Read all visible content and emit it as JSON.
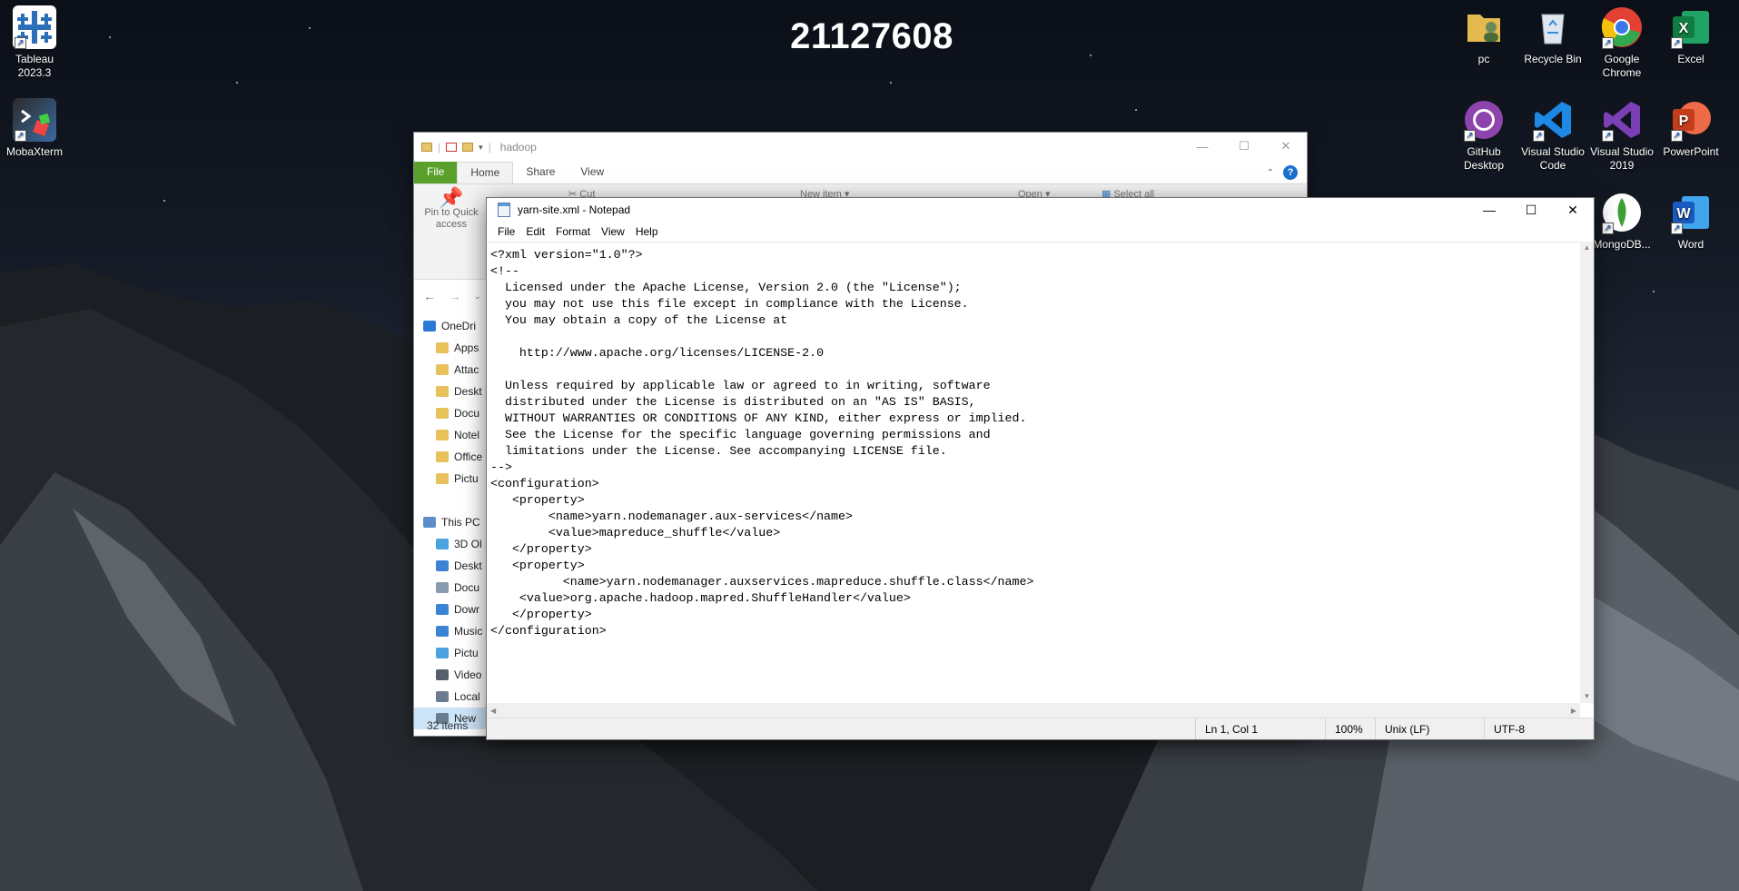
{
  "desktop": {
    "number": "21127608",
    "icons": [
      {
        "label": "Tableau 2023.3",
        "icon": "tableau-icon",
        "color": "#2c6fb8"
      },
      {
        "label": "MobaXterm",
        "icon": "mobaxterm-icon",
        "color": "#3b6aa0"
      },
      {
        "label": "pc",
        "icon": "user-folder-icon",
        "color": "#e4b94d"
      },
      {
        "label": "Recycle Bin",
        "icon": "recycle-bin-icon",
        "color": "#c9d2dc"
      },
      {
        "label": "Google Chrome",
        "icon": "chrome-icon",
        "color": "#e34133"
      },
      {
        "label": "Excel",
        "icon": "excel-icon",
        "color": "#1d7044"
      },
      {
        "label": "GitHub Desktop",
        "icon": "github-desktop-icon",
        "color": "#8e44ad"
      },
      {
        "label": "Visual Studio Code",
        "icon": "vscode-icon",
        "color": "#1e88e5"
      },
      {
        "label": "Visual Studio 2019",
        "icon": "visual-studio-icon",
        "color": "#7b3fb6"
      },
      {
        "label": "PowerPoint",
        "icon": "powerpoint-icon",
        "color": "#c9432a"
      },
      {
        "label": "MongoDB...",
        "icon": "mongodb-icon",
        "color": "#3fa037"
      },
      {
        "label": "Word",
        "icon": "word-icon",
        "color": "#2b5bb5"
      }
    ]
  },
  "explorer": {
    "title": "hadoop",
    "tabs": {
      "file": "File",
      "home": "Home",
      "share": "Share",
      "view": "View"
    },
    "ribbon": {
      "pin": "Pin to Quick access",
      "cut": "Cut",
      "new_item": "New item",
      "open": "Open",
      "select_all": "Select all"
    },
    "sidebar": [
      {
        "label": "OneDri",
        "icon": "onedrive-icon",
        "color": "#2a7ad5",
        "head": true
      },
      {
        "label": "Apps",
        "icon": "folder-icon",
        "color": "#e8c15a"
      },
      {
        "label": "Attac",
        "icon": "folder-icon",
        "color": "#e8c15a"
      },
      {
        "label": "Deskt",
        "icon": "folder-icon",
        "color": "#e8c15a"
      },
      {
        "label": "Docu",
        "icon": "folder-icon",
        "color": "#e8c15a"
      },
      {
        "label": "Notel",
        "icon": "folder-icon",
        "color": "#e8c15a"
      },
      {
        "label": "Office",
        "icon": "folder-icon",
        "color": "#e8c15a"
      },
      {
        "label": "Pictu",
        "icon": "folder-icon",
        "color": "#e8c15a"
      },
      {
        "label": "",
        "icon": "",
        "color": "",
        "spacer": true
      },
      {
        "label": "This PC",
        "icon": "this-pc-icon",
        "color": "#5b8ec9",
        "head": true
      },
      {
        "label": "3D Ol",
        "icon": "3d-objects-icon",
        "color": "#4aa3df"
      },
      {
        "label": "Deskt",
        "icon": "desktop-icon",
        "color": "#3b84d4"
      },
      {
        "label": "Docu",
        "icon": "documents-icon",
        "color": "#8a9bb0"
      },
      {
        "label": "Dowr",
        "icon": "downloads-icon",
        "color": "#3b84d4"
      },
      {
        "label": "Music",
        "icon": "music-icon",
        "color": "#3b84d4"
      },
      {
        "label": "Pictu",
        "icon": "pictures-icon",
        "color": "#4aa3df"
      },
      {
        "label": "Video",
        "icon": "videos-icon",
        "color": "#555e6a"
      },
      {
        "label": "Local",
        "icon": "local-disk-icon",
        "color": "#6b7c90"
      },
      {
        "label": "New",
        "icon": "drive-icon",
        "color": "#6b7c90",
        "selected": true
      }
    ],
    "status": "32 items"
  },
  "notepad": {
    "title": "yarn-site.xml - Notepad",
    "menu": [
      "File",
      "Edit",
      "Format",
      "View",
      "Help"
    ],
    "content": "<?xml version=\"1.0\"?>\n<!--\n  Licensed under the Apache License, Version 2.0 (the \"License\");\n  you may not use this file except in compliance with the License.\n  You may obtain a copy of the License at\n\n    http://www.apache.org/licenses/LICENSE-2.0\n\n  Unless required by applicable law or agreed to in writing, software\n  distributed under the License is distributed on an \"AS IS\" BASIS,\n  WITHOUT WARRANTIES OR CONDITIONS OF ANY KIND, either express or implied.\n  See the License for the specific language governing permissions and\n  limitations under the License. See accompanying LICENSE file.\n-->\n<configuration>\n   <property>\n        <name>yarn.nodemanager.aux-services</name>\n        <value>mapreduce_shuffle</value>\n   </property>\n   <property>\n          <name>yarn.nodemanager.auxservices.mapreduce.shuffle.class</name>\n    <value>org.apache.hadoop.mapred.ShuffleHandler</value>\n   </property>\n</configuration>",
    "status": {
      "position": "Ln 1, Col 1",
      "zoom": "100%",
      "line_ending": "Unix (LF)",
      "encoding": "UTF-8"
    }
  }
}
